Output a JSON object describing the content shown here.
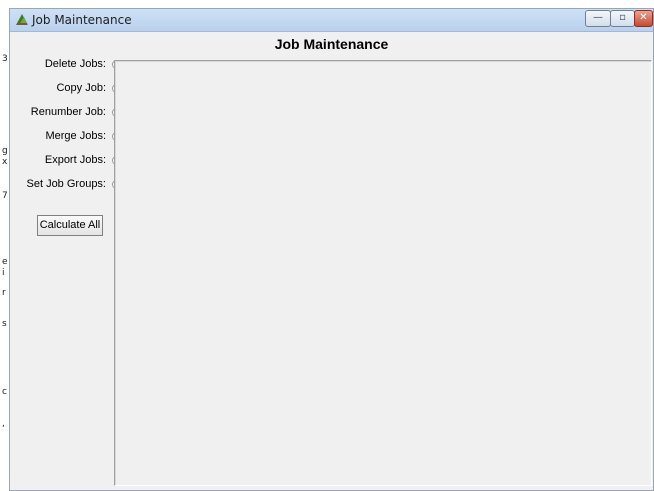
{
  "window": {
    "title": "Job Maintenance",
    "minimize_glyph": "—",
    "maximize_glyph": "▫",
    "close_glyph": "✕"
  },
  "heading": "Job Maintenance",
  "options": [
    {
      "label": "Delete Jobs:",
      "selected": false
    },
    {
      "label": "Copy Job:",
      "selected": false
    },
    {
      "label": "Renumber Job:",
      "selected": false
    },
    {
      "label": "Merge Jobs:",
      "selected": false
    },
    {
      "label": "Export Jobs:",
      "selected": false
    },
    {
      "label": "Set Job Groups:",
      "selected": false
    }
  ],
  "calculate_button": "Calculate All",
  "colors": {
    "window_bg": "#f0f0f0",
    "titlebar": "#c4d8f2",
    "close_button": "#c54a30"
  },
  "background_fragments": [
    "3",
    "g",
    "x",
    "7",
    "e",
    "i",
    "r",
    "s",
    "c",
    ","
  ]
}
